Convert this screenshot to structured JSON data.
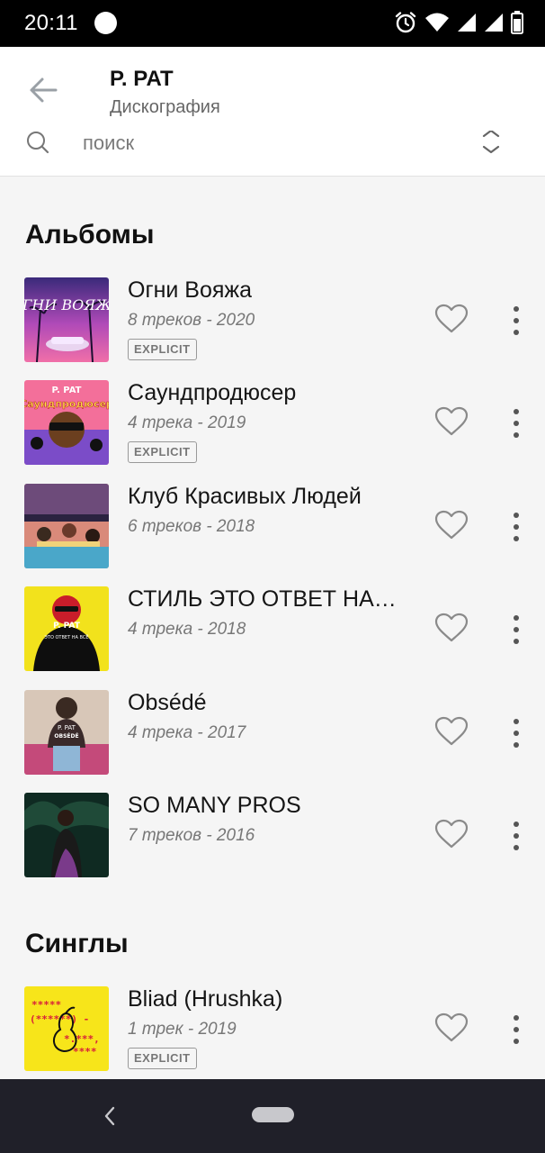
{
  "status_bar": {
    "time": "20:11"
  },
  "header": {
    "title": "P. PAT",
    "subtitle": "Дискография"
  },
  "search": {
    "placeholder": "поиск"
  },
  "albums_section": {
    "title": "Альбомы",
    "items": [
      {
        "name": "Огни Вояжа",
        "meta": "8 треков - 2020",
        "badge": "EXPLICIT"
      },
      {
        "name": "Саундпродюсер",
        "meta": "4 трека - 2019",
        "badge": "EXPLICIT"
      },
      {
        "name": "Клуб Красивых Людей",
        "meta": "6 треков - 2018"
      },
      {
        "name": "СТИЛЬ ЭТО ОТВЕТ НА…",
        "meta": "4 трека - 2018"
      },
      {
        "name": "Obsédé",
        "meta": "4 трека - 2017"
      },
      {
        "name": "SO MANY PROS",
        "meta": "7 треков - 2016"
      }
    ]
  },
  "singles_section": {
    "title": "Синглы",
    "items": [
      {
        "name": "Bliad (Hrushka)",
        "meta": "1 трек - 2019",
        "badge": "EXPLICIT"
      }
    ]
  },
  "cover_text": {
    "album_0": "ОГНИ ВОЯЖА",
    "album_1_top": "P. PAT",
    "album_1_bottom": "Саундпродюсер",
    "album_3_top": "P. PAT",
    "album_3_bottom": "ЭТО ОТВЕТ НА ВСЁ",
    "album_4_top": "P. PAT",
    "album_4_bottom": "OBSÉDÉ"
  },
  "colors": {
    "accent_yellow": "#f7e51a",
    "icon_gray": "#8a8a8a"
  }
}
